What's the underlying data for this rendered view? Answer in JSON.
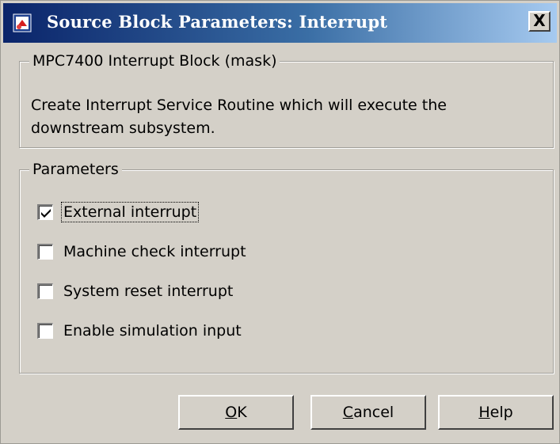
{
  "window": {
    "title": "Source Block Parameters: Interrupt",
    "close_label": "X"
  },
  "mask_group": {
    "legend": "MPC7400 Interrupt Block (mask)",
    "description": "Create Interrupt Service Routine which will execute the downstream subsystem."
  },
  "params_group": {
    "legend": "Parameters",
    "checkboxes": [
      {
        "label": "External interrupt",
        "checked": true
      },
      {
        "label": "Machine check interrupt",
        "checked": false
      },
      {
        "label": "System reset interrupt",
        "checked": false
      },
      {
        "label": "Enable simulation input",
        "checked": false
      }
    ]
  },
  "buttons": {
    "ok": {
      "mnemonic": "O",
      "rest": "K"
    },
    "cancel": {
      "mnemonic": "C",
      "rest": "ancel"
    },
    "help": {
      "mnemonic": "H",
      "rest": "elp"
    }
  },
  "colors": {
    "titlebar_start": "#0a246a",
    "titlebar_end": "#a6caf0",
    "dialog_bg": "#d4d0c8"
  },
  "icons": {
    "title_icon": "simulink-block-icon",
    "check": "checkmark-icon"
  }
}
